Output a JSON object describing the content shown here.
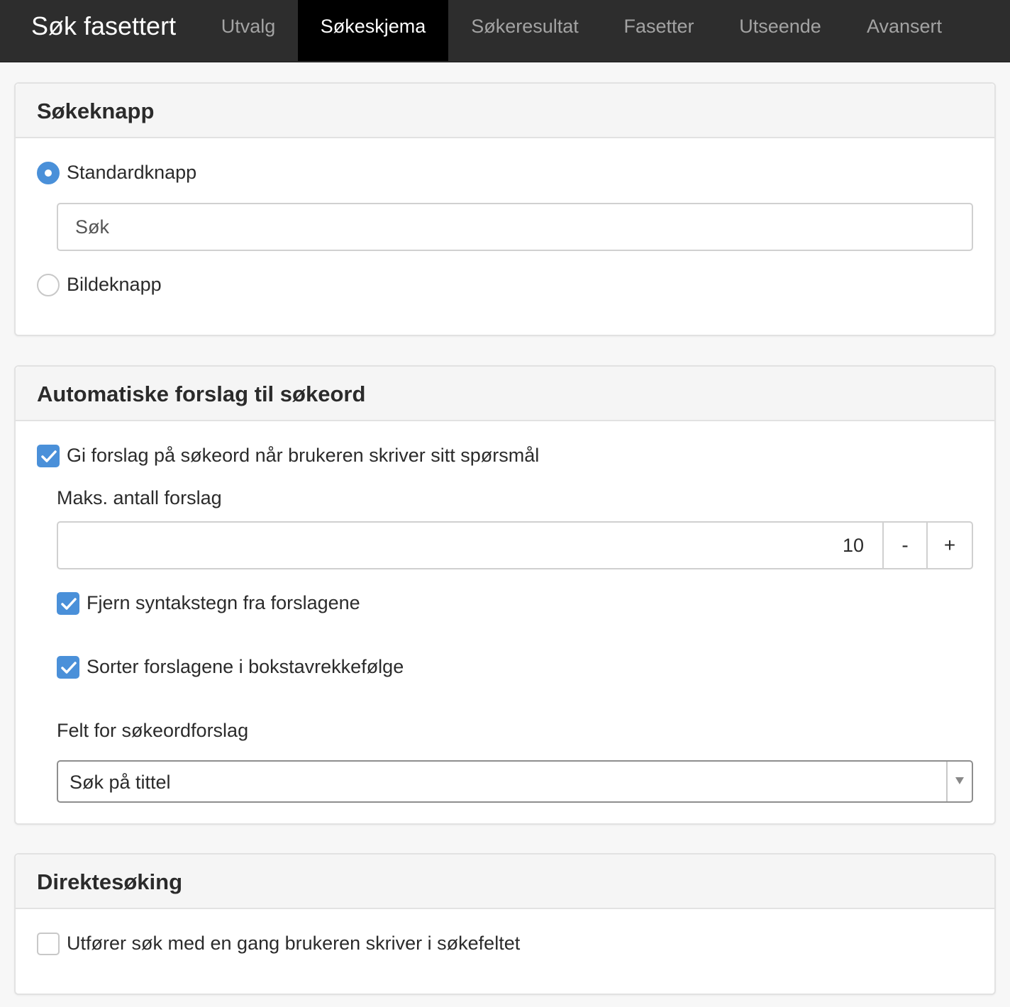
{
  "app": {
    "title": "Søk fasettert"
  },
  "nav": {
    "tabs": [
      {
        "label": "Utvalg",
        "active": false
      },
      {
        "label": "Søkeskjema",
        "active": true
      },
      {
        "label": "Søkeresultat",
        "active": false
      },
      {
        "label": "Fasetter",
        "active": false
      },
      {
        "label": "Utseende",
        "active": false
      },
      {
        "label": "Avansert",
        "active": false
      }
    ]
  },
  "search_button": {
    "heading": "Søkeknapp",
    "option_standard": {
      "label": "Standardknapp",
      "checked": true
    },
    "standard_text_value": "Søk",
    "option_image": {
      "label": "Bildeknapp",
      "checked": false
    }
  },
  "autosuggest": {
    "heading": "Automatiske forslag til søkeord",
    "enable": {
      "label": "Gi forslag på søkeord når brukeren skriver sitt spørsmål",
      "checked": true
    },
    "max_label": "Maks. antall forslag",
    "max_value": "10",
    "decrement_label": "-",
    "increment_label": "+",
    "strip_syntax": {
      "label": "Fjern syntakstegn fra forslagene",
      "checked": true
    },
    "sort_alpha": {
      "label": "Sorter forslagene i bokstavrekkefølge",
      "checked": true
    },
    "field_label": "Felt for søkeordforslag",
    "field_selected": "Søk på tittel"
  },
  "direct_search": {
    "heading": "Direktesøking",
    "instant": {
      "label": "Utfører søk med en gang brukeren skriver i søkefeltet",
      "checked": false
    }
  },
  "colors": {
    "accent": "#4a90d9",
    "navbar": "#2d2d2d",
    "active_tab": "#000000"
  }
}
